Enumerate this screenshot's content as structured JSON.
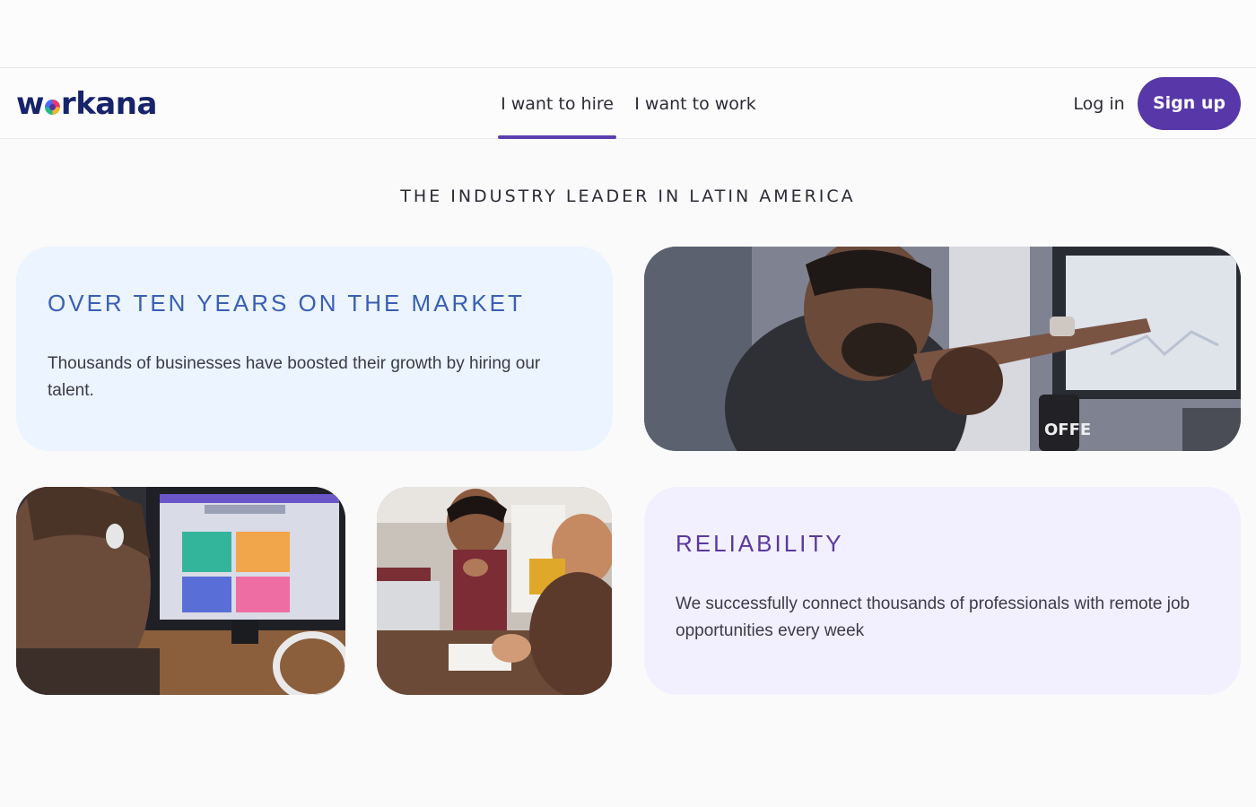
{
  "nav": {
    "logo_text": "workana",
    "tabs": [
      {
        "label": "I want to hire",
        "active": true
      },
      {
        "label": "I want to work",
        "active": false
      }
    ],
    "login_label": "Log in",
    "signup_label": "Sign up"
  },
  "section": {
    "heading": "THE INDUSTRY LEADER IN LATIN AMERICA"
  },
  "cards": {
    "market": {
      "title": "OVER TEN YEARS ON THE MARKET",
      "text": "Thousands of businesses have boosted their growth by hiring our talent."
    },
    "reliability": {
      "title": "RELIABILITY",
      "text": "We successfully connect thousands of professionals with remote job opportunities every week"
    }
  },
  "photos": {
    "p1_mug_text": "OFFE"
  },
  "colors": {
    "accent": "#5837a8",
    "brand_navy": "#17236b",
    "market_card_bg": "#ebf4ff",
    "reliability_card_bg": "#f2efff"
  }
}
